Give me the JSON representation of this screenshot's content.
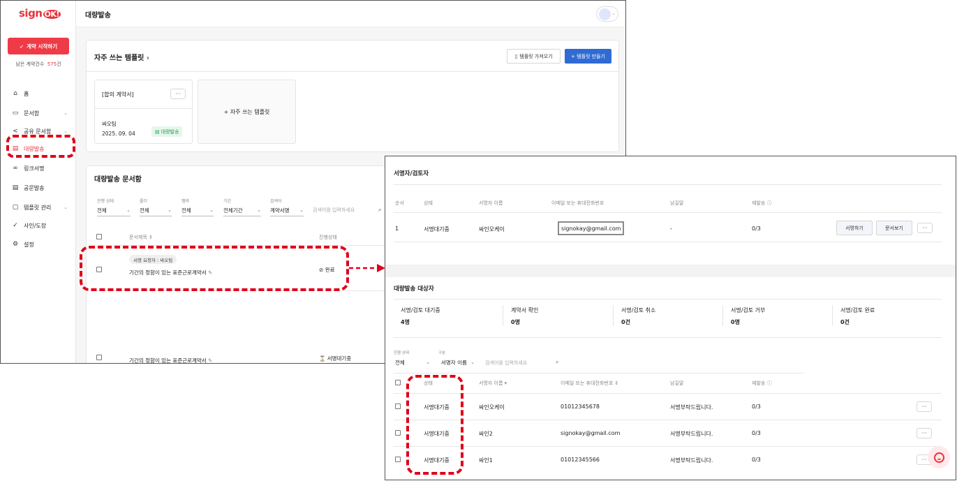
{
  "sidebar": {
    "logo_text": "sign",
    "logo_ok": "OK!",
    "start_button": "계약 시작하기",
    "remain_label": "남은 계약건수",
    "remain_count": "575",
    "remain_unit": "건",
    "items": [
      {
        "label": "홈",
        "icon": "home-icon"
      },
      {
        "label": "문서함",
        "icon": "folder-icon",
        "has_chevron": true
      },
      {
        "label": "공유 문서함",
        "icon": "share-icon",
        "has_chevron": true
      },
      {
        "label": "대량발송",
        "icon": "bulk-doc-icon",
        "active": true
      },
      {
        "label": "링크서명",
        "icon": "link-icon"
      },
      {
        "label": "공문발송",
        "icon": "document-icon"
      },
      {
        "label": "템플릿 관리",
        "icon": "template-icon",
        "has_chevron": true
      },
      {
        "label": "사인/도장",
        "icon": "signature-icon"
      },
      {
        "label": "설정",
        "icon": "gear-icon"
      }
    ]
  },
  "header": {
    "title": "대량발송"
  },
  "templates": {
    "title": "자주 쓰는 템플릿",
    "import_button": "템플릿 가져오기",
    "create_button": "+ 템플릿 만들기",
    "card": {
      "name": "[합의 계약서]",
      "author": "싸오팀",
      "date": "2025. 09. 04",
      "badge": "대량발송"
    },
    "add_card": "+ 자주 쓰는 템플릿"
  },
  "bulk_box": {
    "title": "대량발송 문서함",
    "filters": [
      {
        "label": "진행 상태",
        "value": "전체"
      },
      {
        "label": "폴더",
        "value": "전체"
      },
      {
        "label": "멤버",
        "value": "전체"
      },
      {
        "label": "기간",
        "value": "전체기간"
      },
      {
        "label": "검색어",
        "value": "계약서명"
      }
    ],
    "search_placeholder": "검색어를 입력하세요",
    "col_title": "문서제목",
    "col_status": "진행상태",
    "rows": [
      {
        "requester": "서명 요청자 : 싸오팀",
        "title": "기간의 정함이 있는 표준근로계약서",
        "status": "완료"
      },
      {
        "title": "기간의 정함이 있는 표준근로계약서",
        "status": "서명대기중"
      }
    ]
  },
  "signers": {
    "title": "서명자/검토자",
    "columns": [
      "순서",
      "상태",
      "서명자 이름",
      "이메일 또는 휴대전화번호",
      "남길말",
      "재발송"
    ],
    "row": {
      "order": "1",
      "status": "서명대기중",
      "name": "싸인오케이",
      "contact": "signokay@gmail.com",
      "message": "-",
      "resend": "0/3"
    },
    "sign_button": "서명하기",
    "view_button": "문서보기"
  },
  "targets": {
    "title": "대량발송 대상자",
    "stats": [
      {
        "label": "서명/검토 대기중",
        "value": "4명"
      },
      {
        "label": "계약서 확인",
        "value": "0명"
      },
      {
        "label": "서명/검토 취소",
        "value": "0건"
      },
      {
        "label": "서명/검토 거부",
        "value": "0명"
      },
      {
        "label": "서명/검토 완료",
        "value": "0건"
      }
    ],
    "filter_status_label": "진행 상태",
    "filter_status_value": "전체",
    "filter_type_label": "구분",
    "filter_type_value": "서명자 이름",
    "search_placeholder": "검색어를 입력하세요",
    "columns": [
      "상태",
      "서명자 이름",
      "이메일 또는 휴대전화번호",
      "남길말",
      "재발송"
    ],
    "rows": [
      {
        "status": "서명대기중",
        "name": "싸인오케이",
        "contact": "01012345678",
        "message": "서명부탁드립니다.",
        "resend": "0/3"
      },
      {
        "status": "서명대기중",
        "name": "싸인2",
        "contact": "signokay@gmail.com",
        "message": "서명부탁드립니다.",
        "resend": "0/3"
      },
      {
        "status": "서명대기중",
        "name": "싸인1",
        "contact": "01012345566",
        "message": "서명부탁드립니다.",
        "resend": "0/3"
      }
    ]
  },
  "colors": {
    "brand_red": "#e8323c",
    "primary_blue": "#2f6bd3",
    "highlight_red": "#e0001a"
  }
}
